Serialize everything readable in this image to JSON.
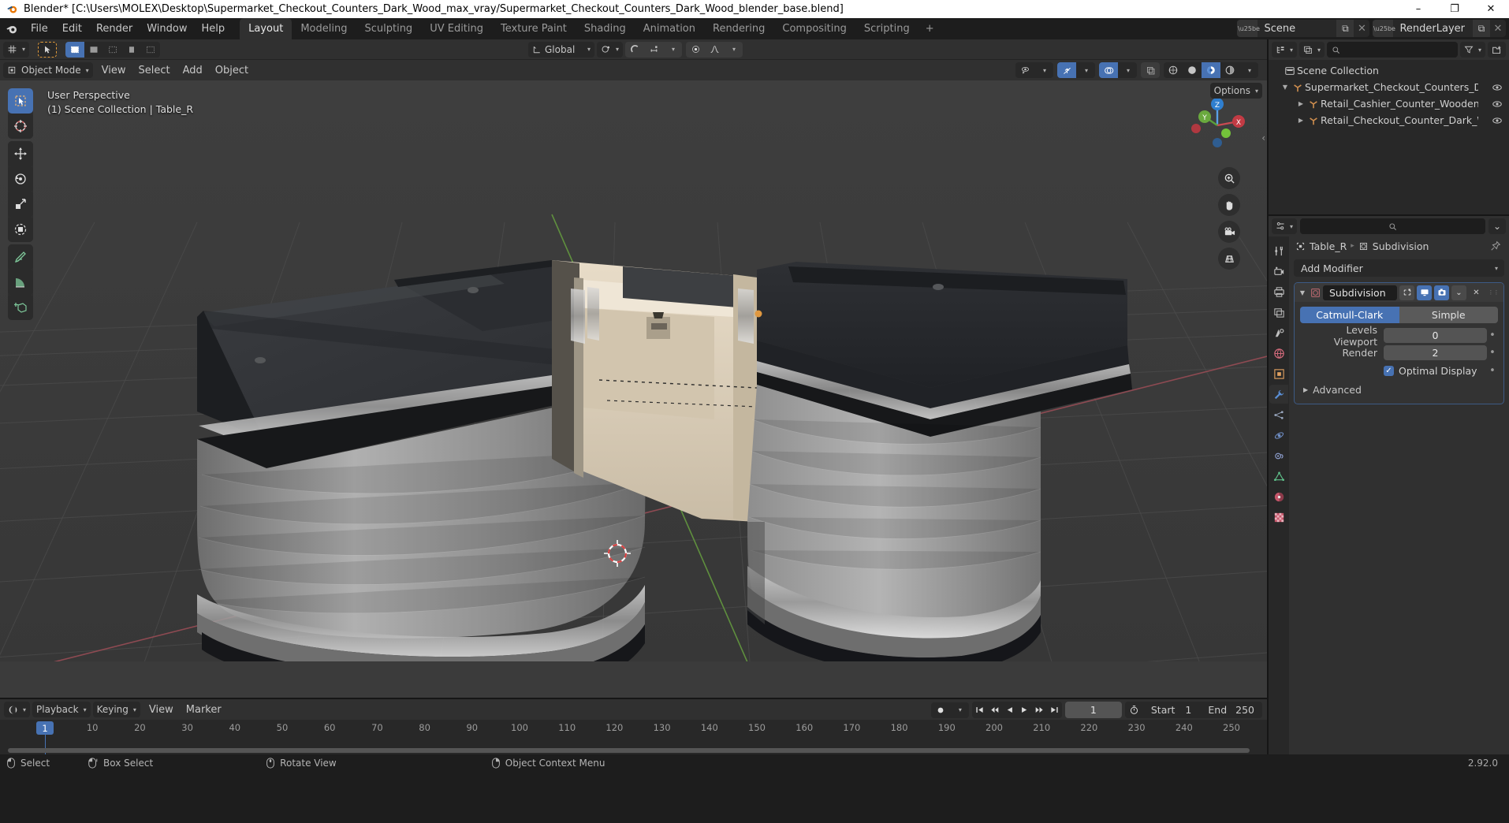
{
  "window": {
    "title": "Blender* [C:\\Users\\MOLEX\\Desktop\\Supermarket_Checkout_Counters_Dark_Wood_max_vray/Supermarket_Checkout_Counters_Dark_Wood_blender_base.blend]",
    "minimize": "–",
    "maximize": "❐",
    "close": "✕"
  },
  "topbar": {
    "menus": [
      "File",
      "Edit",
      "Render",
      "Window",
      "Help"
    ],
    "workspaces": [
      "Layout",
      "Modeling",
      "Sculpting",
      "UV Editing",
      "Texture Paint",
      "Shading",
      "Animation",
      "Rendering",
      "Compositing",
      "Scripting"
    ],
    "active_workspace": "Layout",
    "add_workspace": "+",
    "scene_name": "Scene",
    "viewlayer_name": "RenderLayer",
    "new_icon": "⧉",
    "unlink_icon": "✕"
  },
  "viewport": {
    "header_top": {
      "editor_type_icon": "editor-type-icon",
      "select_tool_icon": "cursor-select-icon",
      "select_modes": [
        "set",
        "extend",
        "subtract",
        "invert",
        "intersect"
      ],
      "transform_orientation": "Global",
      "pivot_icon": "pivot-point-icon",
      "snap_icon": "snap-magnet-icon",
      "proportional_icon": "proportional-edit-icon",
      "falloff_icon": "falloff-curve-icon"
    },
    "header_bottom": {
      "mode": "Object Mode",
      "menus": [
        "View",
        "Select",
        "Add",
        "Object"
      ],
      "options_label": "Options",
      "visibility_icon": "eye-visibility-icon",
      "gizmo_icon": "gizmo-icon",
      "overlays_icon": "overlays-icon",
      "xray_icon": "xray-toggle-icon",
      "shading_modes": [
        "wireframe",
        "solid",
        "material-preview",
        "rendered"
      ],
      "active_shading": "material-preview"
    },
    "overlay_line1": "User Perspective",
    "overlay_line2": "(1) Scene Collection | Table_R",
    "toolbar_tools": [
      "tweak-select",
      "cursor",
      "move",
      "rotate",
      "scale",
      "transform",
      "annotate",
      "measure",
      "add-cube"
    ],
    "active_tool": "tweak-select",
    "gizmo_axes": [
      "Z",
      "Y",
      "X"
    ],
    "nav_buttons": [
      "zoom-icon",
      "pan-hand-icon",
      "camera-view-icon",
      "toggle-perspective-icon"
    ],
    "colors": {
      "bg": "#3b3b3b",
      "grid": "#4a4a4a",
      "axis_x": "#9a4a52",
      "axis_y": "#5a8a3c",
      "accent": "#4772b3",
      "counter_top": "#2b2d30",
      "counter_body": "#9a9a9a",
      "interior": "#ddd0bd"
    }
  },
  "timeline": {
    "editor_icon": "timeline-editor-icon",
    "menus": [
      "Playback",
      "Keying",
      "View",
      "Marker"
    ],
    "auto_key_icon": "record-dot-icon",
    "transport": [
      "jump-start",
      "prev-keyframe",
      "play-reverse",
      "play",
      "next-keyframe",
      "jump-end"
    ],
    "current_frame": "1",
    "use_preview_icon": "stopwatch-icon",
    "start_label": "Start",
    "start_value": "1",
    "end_label": "End",
    "end_value": "250",
    "ticks": [
      "10",
      "20",
      "30",
      "40",
      "50",
      "60",
      "70",
      "80",
      "90",
      "100",
      "110",
      "120",
      "130",
      "140",
      "150",
      "160",
      "170",
      "180",
      "190",
      "200",
      "210",
      "220",
      "230",
      "240",
      "250"
    ],
    "playhead_frame": "1"
  },
  "outliner": {
    "display_mode_icon": "outliner-display-mode-icon",
    "filter_id_icon": "blender-file-icon",
    "search_placeholder": "",
    "filter_icon": "funnel-filter-icon",
    "new_collection_icon": "new-collection-icon",
    "rows": [
      {
        "indent": 0,
        "disclosure": "",
        "icon": "collection-icon",
        "label": "Scene Collection",
        "eye": false
      },
      {
        "indent": 1,
        "disclosure": "▼",
        "icon": "empty-axes-icon",
        "label": "Supermarket_Checkout_Counters_Dark_Woc",
        "eye": true
      },
      {
        "indent": 2,
        "disclosure": "▶",
        "icon": "empty-axes-icon",
        "label": "Retail_Cashier_Counter_Wooden_Dark",
        "eye": true
      },
      {
        "indent": 2,
        "disclosure": "▶",
        "icon": "empty-axes-icon",
        "label": "Retail_Checkout_Counter_Dark_Wood",
        "eye": true
      }
    ]
  },
  "properties": {
    "editor_icon": "properties-editor-icon",
    "search_placeholder": "",
    "options_chevron": "⌄",
    "tabs": [
      "tool",
      "render",
      "output",
      "view-layer",
      "scene",
      "world",
      "object",
      "modifier",
      "particles",
      "physics",
      "constraints",
      "object-data",
      "material",
      "texture"
    ],
    "active_tab": "modifier",
    "breadcrumb_object": "Table_R",
    "breadcrumb_modifier": "Subdivision",
    "pin_icon": "pin-icon",
    "add_modifier": "Add Modifier",
    "modifier": {
      "icon": "subsurf-modifier-icon",
      "name": "Subdivision",
      "toggles": [
        "edit-mode-cage",
        "edit-mode-display",
        "realtime-display",
        "render-display"
      ],
      "extras_icon": "⌄",
      "close_icon": "✕",
      "drag_icon": "⋮⋮",
      "algorithm_options": [
        "Catmull-Clark",
        "Simple"
      ],
      "algorithm_selected": "Catmull-Clark",
      "levels_viewport_label": "Levels Viewport",
      "levels_viewport_value": "0",
      "render_label": "Render",
      "render_value": "2",
      "optimal_display_label": "Optimal Display",
      "optimal_display_checked": true,
      "advanced_label": "Advanced",
      "advanced_disclosure": "▶"
    }
  },
  "statusbar": {
    "items": [
      {
        "icon": "mouse-left-icon",
        "label": "Select"
      },
      {
        "icon": "mouse-left-drag-icon",
        "label": "Box Select"
      },
      {
        "icon": "mouse-middle-icon",
        "label": "Rotate View"
      },
      {
        "icon": "mouse-right-icon",
        "label": "Object Context Menu"
      }
    ],
    "version": "2.92.0"
  }
}
